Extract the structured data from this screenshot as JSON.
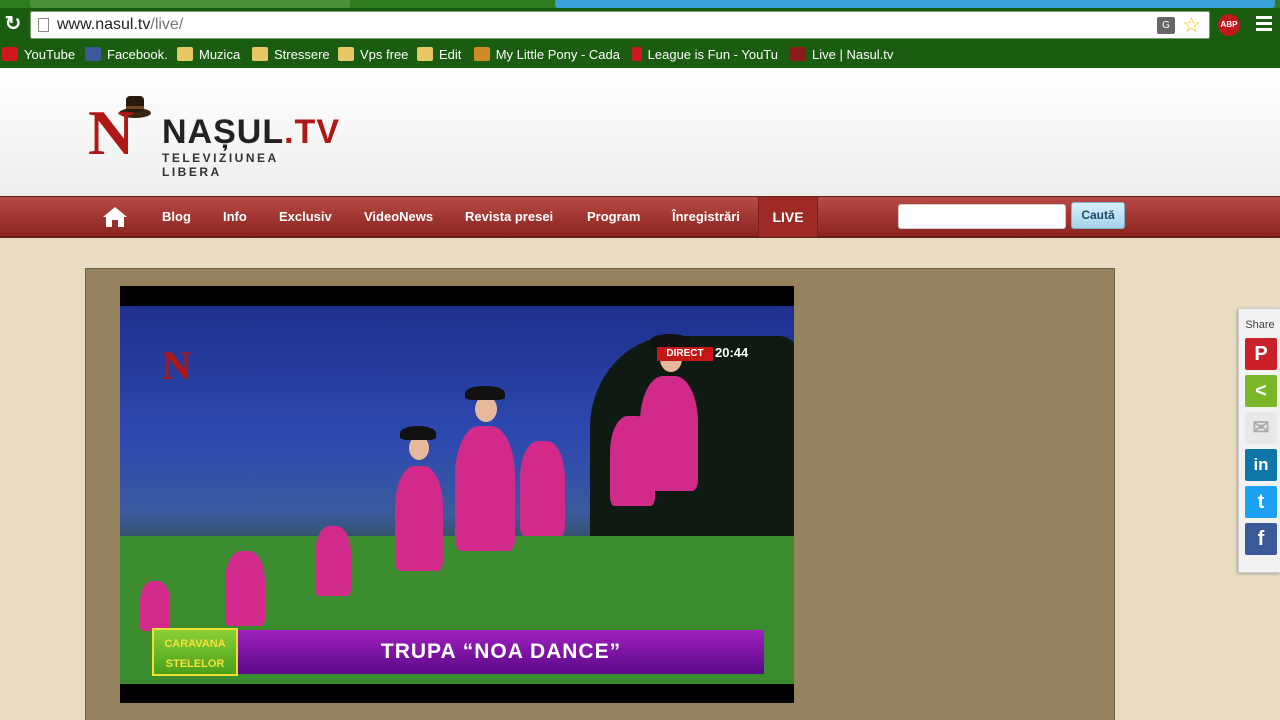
{
  "browser": {
    "url_host": "www.nasul.tv",
    "url_path": "/live/",
    "translate_icon": "translate-icon",
    "adblock_label": "ABP",
    "bookmarks": [
      {
        "label": "YouTube",
        "icon": "youtube-icon"
      },
      {
        "label": "Facebook.",
        "icon": "facebook-icon"
      },
      {
        "label": "Muzica",
        "icon": "folder-icon"
      },
      {
        "label": "Stressere",
        "icon": "folder-icon"
      },
      {
        "label": "Vps free",
        "icon": "folder-icon"
      },
      {
        "label": "Edit",
        "icon": "folder-icon"
      },
      {
        "label": "My Little Pony - Cada",
        "icon": "pony-icon"
      },
      {
        "label": "League is Fun - YouTu",
        "icon": "youtube-icon"
      },
      {
        "label": "Live | Nasul.tv",
        "icon": "nasul-icon"
      }
    ]
  },
  "site": {
    "logo_letter": "N",
    "logo_name": "NAȘUL",
    "logo_tld": ".TV",
    "tagline": "TELEVIZIUNEA LIBERA",
    "nav": [
      "Blog",
      "Info",
      "Exclusiv",
      "VideoNews",
      "Revista presei",
      "Program",
      "Înregistrări"
    ],
    "nav_live": "LIVE",
    "search_button": "Caută"
  },
  "video": {
    "channel_logo": "N",
    "badge": "DIRECT",
    "time": "20:44",
    "show_logo": "CARAVANA\nSTELELOR",
    "caption": "TRUPA “NOA DANCE”"
  },
  "share": {
    "label": "Share",
    "buttons": [
      {
        "name": "pinterest",
        "glyph": "P",
        "color": "#cb2027"
      },
      {
        "name": "sharethis",
        "glyph": "<",
        "color": "#7ab829"
      },
      {
        "name": "email",
        "glyph": "✉",
        "color": "#e8e8e8"
      },
      {
        "name": "linkedin",
        "glyph": "in",
        "color": "#0e76a8"
      },
      {
        "name": "twitter",
        "glyph": "t",
        "color": "#1da1f2"
      },
      {
        "name": "facebook",
        "glyph": "f",
        "color": "#3b5998"
      }
    ]
  }
}
